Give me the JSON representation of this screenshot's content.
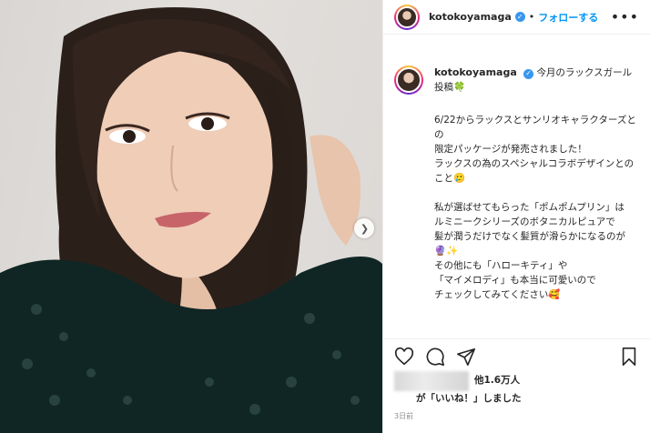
{
  "post": {
    "username": "kotokoyamaga",
    "verified_icon": "verified-badge-icon",
    "separator": "•",
    "follow_label": "フォローする",
    "more_icon": "ellipsis-icon"
  },
  "caption": {
    "username": "kotokoyamaga",
    "head": "今月のラックスガール投稿🍀",
    "body": "6/22からラックスとサンリオキャラクターズとの\n限定パッケージが発売されました！\nラックスの為のスペシャルコラボデザインとのこと🥲\n\n私が選ばせてもらった「ポムポムプリン」は\nルミニークシリーズのボタニカルピュアで\n髪が潤うだけでなく髪質が滑らかになるのが🔮✨\nその他にも「ハローキティ」や\n「マイメロディ」も本当に可愛いので\nチェックしてみてください🥰"
  },
  "actions": {
    "like_icon": "heart-icon",
    "comment_icon": "comment-icon",
    "share_icon": "share-icon",
    "save_icon": "bookmark-icon"
  },
  "likes": {
    "count": "他1.6万人",
    "line2": "が「いいね！」しました"
  },
  "timestamp": "3日前",
  "carousel": {
    "next_icon": "chevron-right-icon"
  }
}
